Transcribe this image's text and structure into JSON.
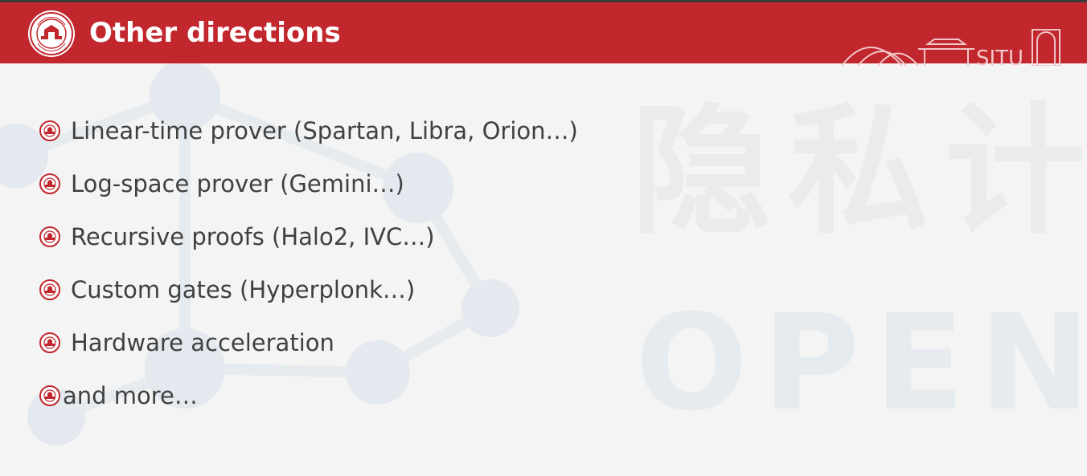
{
  "slide": {
    "title": "Other directions",
    "colors": {
      "header": "#c1272d",
      "text": "#404040",
      "background": "#f4f4f4",
      "watermark": "#e3e8ec"
    }
  },
  "bullets": [
    {
      "text": "Linear-time prover (Spartan, Libra, Orion…)",
      "icon": "university-seal-bullet-icon"
    },
    {
      "text": "Log-space prover (Gemini…)",
      "icon": "university-seal-bullet-icon"
    },
    {
      "text": "Recursive proofs (Halo2, IVC…)",
      "icon": "university-seal-bullet-icon"
    },
    {
      "text": "Custom gates (Hyperplonk…)",
      "icon": "university-seal-bullet-icon"
    },
    {
      "text": "Hardware acceleration",
      "icon": "university-seal-bullet-icon"
    },
    {
      "text": "and more…",
      "icon": "university-seal-bullet-icon"
    }
  ],
  "watermark_text": {
    "chinese": "隐私计",
    "latin": "OPEN"
  },
  "header_mark": {
    "text": "SJTU"
  }
}
